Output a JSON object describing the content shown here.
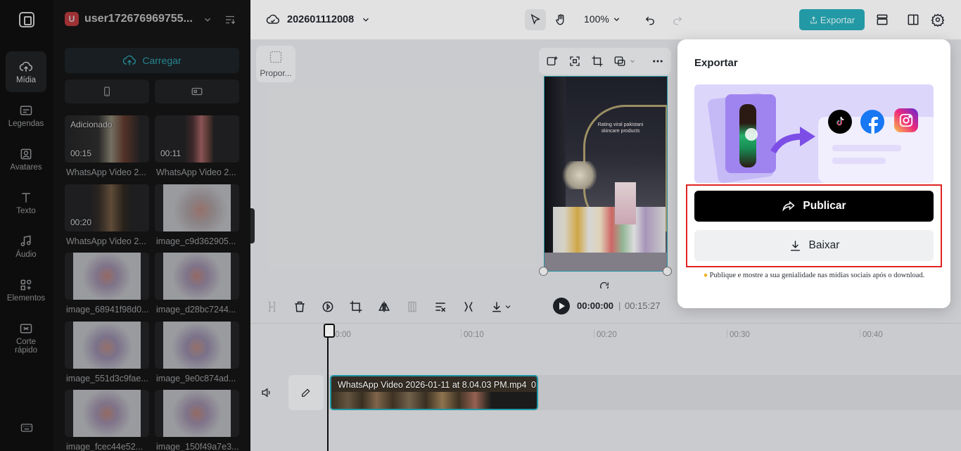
{
  "rail": {
    "items": [
      {
        "label": "Mídia",
        "icon": "cloud-upload-icon"
      },
      {
        "label": "Legendas",
        "icon": "captions-icon"
      },
      {
        "label": "Avatares",
        "icon": "avatar-icon"
      },
      {
        "label": "Texto",
        "icon": "text-icon"
      },
      {
        "label": "Áudio",
        "icon": "music-note-icon"
      },
      {
        "label": "Elementos",
        "icon": "elements-icon"
      },
      {
        "label": "Corte rápido",
        "icon": "quick-cut-icon"
      }
    ]
  },
  "media": {
    "username": "user172676969755...",
    "avatar_letter": "U",
    "upload_label": "Carregar",
    "thumbs": [
      {
        "name": "WhatsApp Video 2...",
        "duration": "00:15",
        "badge": "Adicionado"
      },
      {
        "name": "WhatsApp Video 2...",
        "duration": "00:11",
        "badge": ""
      },
      {
        "name": "WhatsApp Video 2...",
        "duration": "00:20",
        "badge": ""
      },
      {
        "name": "image_c9d362905...",
        "duration": "",
        "badge": ""
      },
      {
        "name": "image_68941f98d0...",
        "duration": "",
        "badge": ""
      },
      {
        "name": "image_d28bc7244...",
        "duration": "",
        "badge": ""
      },
      {
        "name": "image_551d3c9fae...",
        "duration": "",
        "badge": ""
      },
      {
        "name": "image_9e0c874ad...",
        "duration": "",
        "badge": ""
      },
      {
        "name": "image_fcec44e52...",
        "duration": "",
        "badge": ""
      },
      {
        "name": "image_150f49a7e3...",
        "duration": "",
        "badge": ""
      }
    ]
  },
  "topbar": {
    "project_name": "202601112008",
    "zoom": "100%",
    "export_label": "Exportar"
  },
  "canvas": {
    "ratio_label": "Propor...",
    "preview_caption": "Rating viral pakistani skincare products"
  },
  "timeline": {
    "current_time": "00:00:00",
    "separator": "|",
    "total_time": "00:15:27",
    "ruler": [
      "00:00",
      "00:10",
      "00:20",
      "00:30",
      "00:40"
    ],
    "clip_name": "WhatsApp Video 2026-01-11 at 8.04.03 PM.mp4",
    "clip_suffix": "0"
  },
  "export_modal": {
    "title": "Exportar",
    "publish_label": "Publicar",
    "download_label": "Baixar",
    "hint": "Publique e mostre a sua genialidade nas mídias sociais após o download."
  },
  "colors": {
    "accent": "#26a6b4",
    "highlight": "#e02424"
  }
}
